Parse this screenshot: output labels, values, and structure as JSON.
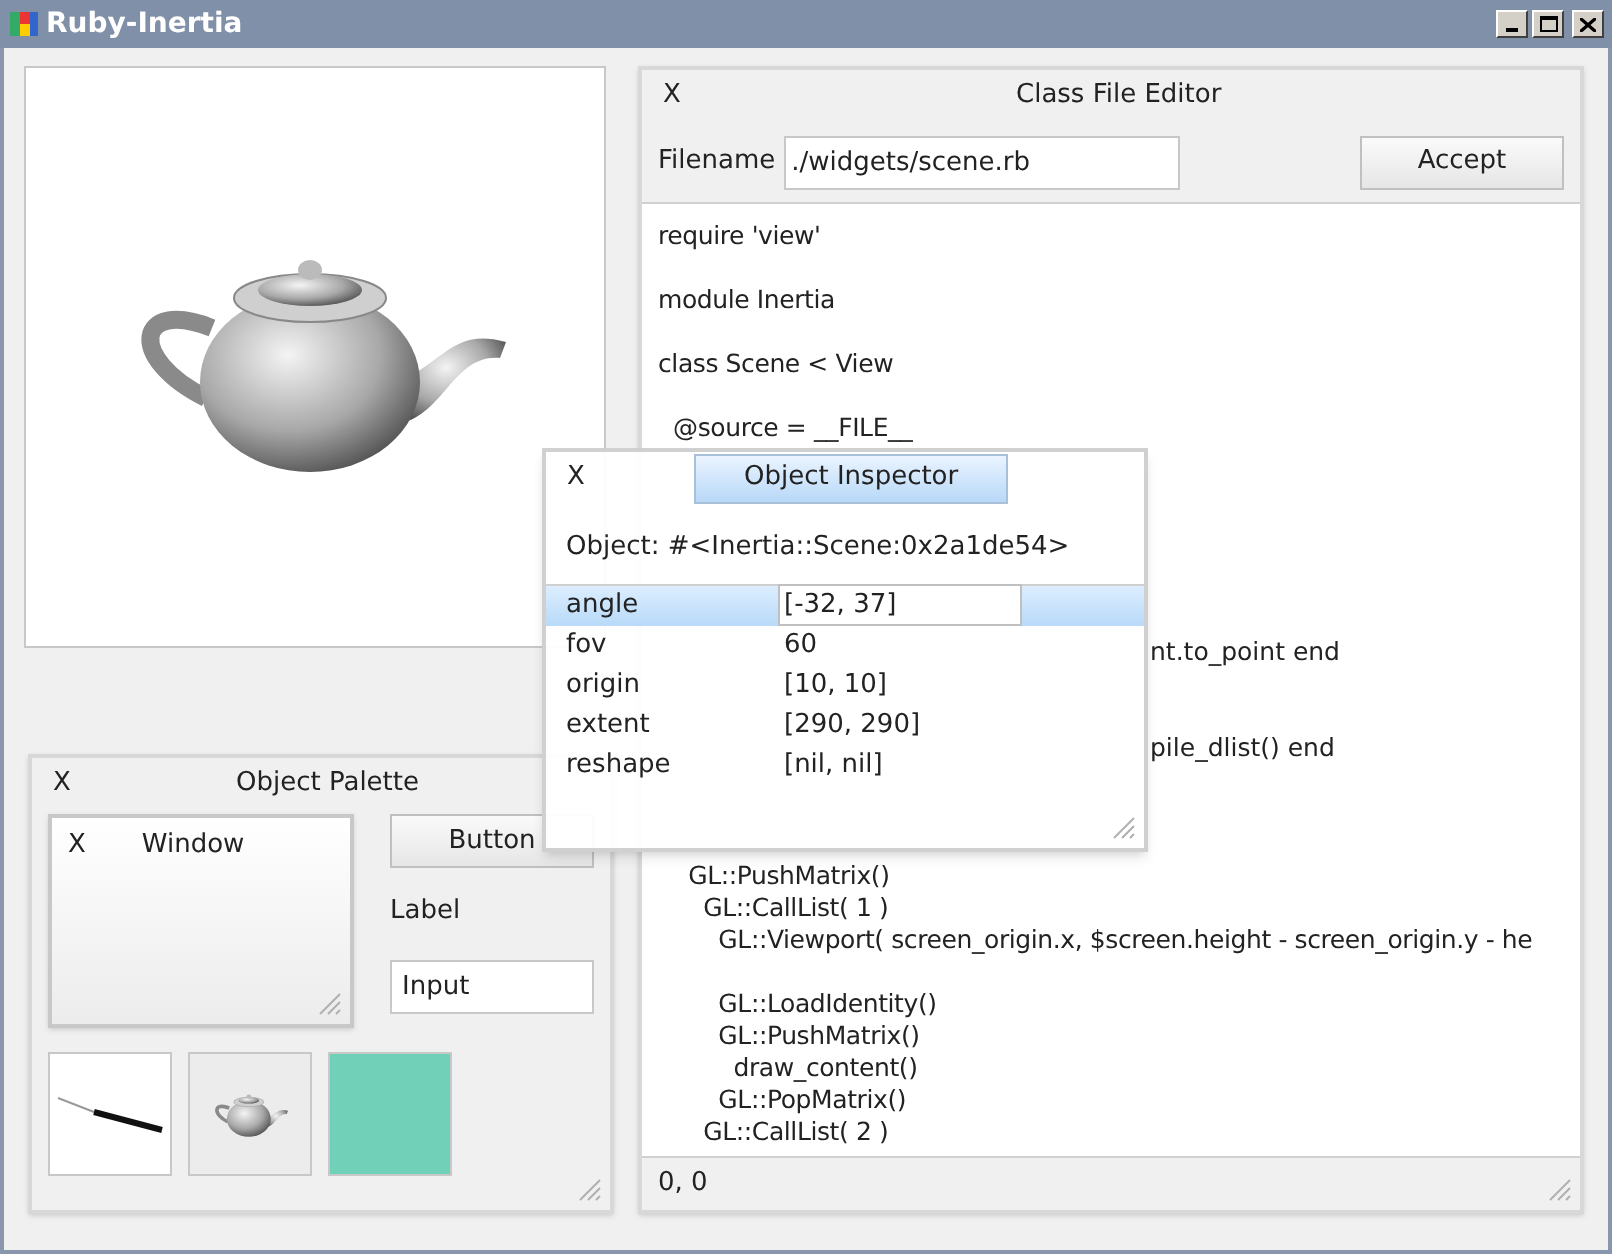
{
  "window": {
    "title": "Ruby-Inertia"
  },
  "editor": {
    "close": "X",
    "title": "Class File Editor",
    "filename_label": "Filename",
    "filename_value": "./widgets/scene.rb",
    "accept": "Accept",
    "lines": [
      {
        "kind": "code",
        "text": "require 'view'"
      },
      {
        "kind": "blank"
      },
      {
        "kind": "code",
        "text": "module Inertia"
      },
      {
        "kind": "blank"
      },
      {
        "kind": "code",
        "text": "class Scene < View"
      },
      {
        "kind": "blank"
      },
      {
        "kind": "code",
        "text": "  @source = __FILE__"
      },
      {
        "kind": "blank"
      },
      {
        "kind": "blank"
      },
      {
        "kind": "blank"
      },
      {
        "kind": "blank"
      },
      {
        "kind": "blank"
      },
      {
        "kind": "blank"
      },
      {
        "kind": "tail",
        "text": "nt.to_point end"
      },
      {
        "kind": "blank"
      },
      {
        "kind": "blank"
      },
      {
        "kind": "tail",
        "text": "pile_dlist() end"
      },
      {
        "kind": "blank"
      },
      {
        "kind": "blank"
      },
      {
        "kind": "blank"
      },
      {
        "kind": "code",
        "text": "    GL::PushMatrix()"
      },
      {
        "kind": "code",
        "text": "      GL::CallList( 1 )"
      },
      {
        "kind": "code",
        "text": "        GL::Viewport( screen_origin.x, $screen.height - screen_origin.y - he"
      },
      {
        "kind": "blank"
      },
      {
        "kind": "code",
        "text": "        GL::LoadIdentity()"
      },
      {
        "kind": "code",
        "text": "        GL::PushMatrix()"
      },
      {
        "kind": "code",
        "text": "          draw_content()"
      },
      {
        "kind": "code",
        "text": "        GL::PopMatrix()"
      },
      {
        "kind": "code",
        "text": "      GL::CallList( 2 )"
      }
    ],
    "status": "0, 0"
  },
  "inspector": {
    "close": "X",
    "title": "Object Inspector",
    "object": "Object: #<Inertia::Scene:0x2a1de54>",
    "rows": [
      {
        "name": "angle",
        "value": "[-32, 37]",
        "selected": true
      },
      {
        "name": "fov",
        "value": "60",
        "selected": false
      },
      {
        "name": "origin",
        "value": "[10, 10]",
        "selected": false
      },
      {
        "name": "extent",
        "value": "[290, 290]",
        "selected": false
      },
      {
        "name": "reshape",
        "value": "[nil, nil]",
        "selected": false
      }
    ]
  },
  "palette": {
    "close": "X",
    "title": "Object Palette",
    "window": {
      "close": "X",
      "title": "Window"
    },
    "button": "Button",
    "label": "Label",
    "input": "Input"
  }
}
